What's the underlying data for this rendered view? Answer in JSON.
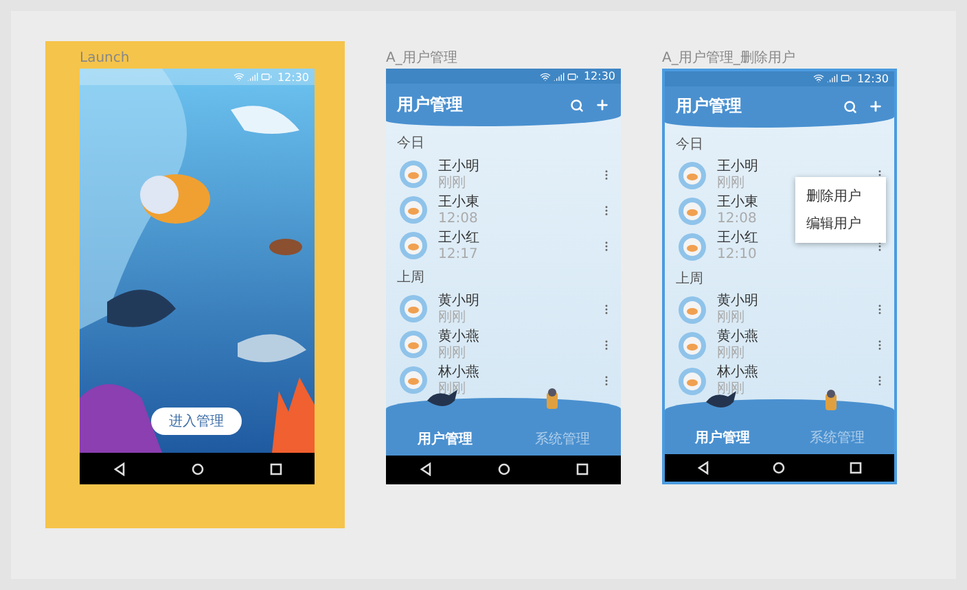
{
  "artboards": [
    {
      "kind": "launch",
      "label": "Launch",
      "selected": false,
      "status_time": "12:30",
      "button": "进入管理"
    },
    {
      "kind": "list",
      "label": "A_用户管理",
      "selected": false,
      "status_time": "12:30",
      "title": "用户管理",
      "sections": [
        {
          "header": "今日",
          "users": [
            {
              "name": "王小明",
              "time": "刚刚"
            },
            {
              "name": "王小東",
              "time": "12:08"
            },
            {
              "name": "王小红",
              "time": "12:17"
            }
          ]
        },
        {
          "header": "上周",
          "users": [
            {
              "name": "黄小明",
              "time": "刚刚"
            },
            {
              "name": "黄小燕",
              "time": "刚刚"
            },
            {
              "name": "林小燕",
              "time": "刚刚"
            }
          ]
        }
      ],
      "tabs": [
        {
          "label": "用户管理",
          "selected": true
        },
        {
          "label": "系统管理",
          "selected": false
        }
      ]
    },
    {
      "kind": "list",
      "label": "A_用户管理_删除用户",
      "selected": true,
      "status_time": "12:30",
      "title": "用户管理",
      "sections": [
        {
          "header": "今日",
          "users": [
            {
              "name": "王小明",
              "time": "刚刚"
            },
            {
              "name": "王小東",
              "time": "12:08"
            },
            {
              "name": "王小红",
              "time": "12:10"
            }
          ]
        },
        {
          "header": "上周",
          "users": [
            {
              "name": "黄小明",
              "time": "刚刚"
            },
            {
              "name": "黄小燕",
              "time": "刚刚"
            },
            {
              "name": "林小燕",
              "time": "刚刚"
            }
          ]
        }
      ],
      "menu": [
        "删除用户",
        "编辑用户"
      ],
      "tabs": [
        {
          "label": "用户管理",
          "selected": true
        },
        {
          "label": "系统管理",
          "selected": false
        }
      ]
    }
  ]
}
